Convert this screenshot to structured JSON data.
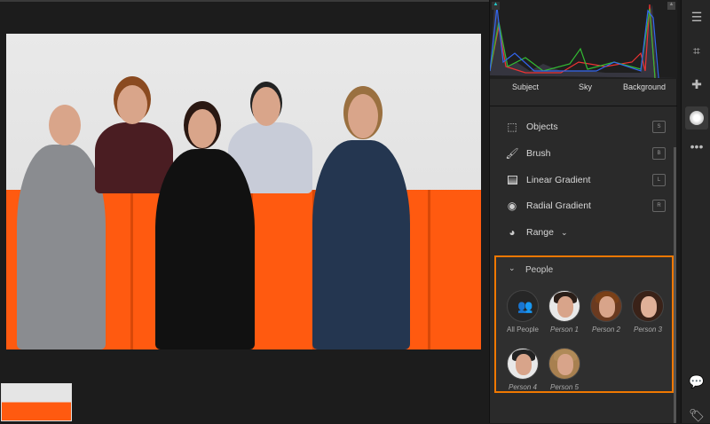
{
  "histogram": {
    "labels": [
      "Subject",
      "Sky",
      "Background"
    ]
  },
  "tools": [
    {
      "label": "Objects",
      "key": "S",
      "icon": "objects-icon"
    },
    {
      "label": "Brush",
      "key": "B",
      "icon": "brush-icon"
    },
    {
      "label": "Linear Gradient",
      "key": "L",
      "icon": "linear-gradient-icon"
    },
    {
      "label": "Radial Gradient",
      "key": "R",
      "icon": "radial-gradient-icon"
    },
    {
      "label": "Range",
      "icon": "range-icon"
    }
  ],
  "people": {
    "title": "People",
    "items": [
      {
        "label": "All People"
      },
      {
        "label": "Person 1"
      },
      {
        "label": "Person 2"
      },
      {
        "label": "Person 3"
      },
      {
        "label": "Person 4"
      },
      {
        "label": "Person 5"
      }
    ]
  },
  "colors": {
    "accent": "#f07800",
    "screen": "#ff5a10"
  }
}
